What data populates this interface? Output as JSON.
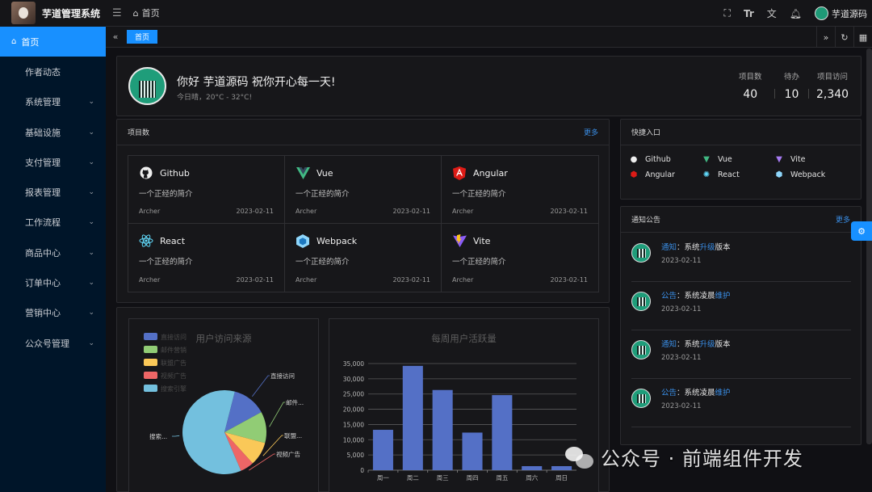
{
  "header": {
    "title": "芋道管理系统",
    "breadcrumb": "首页",
    "username": "芋道源码",
    "icons": [
      "fullscreen-icon",
      "font-size-icon",
      "translate-icon",
      "bell-icon"
    ]
  },
  "sidebar": {
    "items": [
      {
        "label": "首页",
        "active": true
      },
      {
        "label": "作者动态"
      },
      {
        "label": "系统管理"
      },
      {
        "label": "基础设施"
      },
      {
        "label": "支付管理"
      },
      {
        "label": "报表管理"
      },
      {
        "label": "工作流程"
      },
      {
        "label": "商品中心"
      },
      {
        "label": "订单中心"
      },
      {
        "label": "营销中心"
      },
      {
        "label": "公众号管理"
      }
    ]
  },
  "tabs": {
    "active": "首页"
  },
  "greeting": {
    "title": "你好 芋道源码 祝你开心每一天!",
    "weather": "今日晴，20°C - 32°C!",
    "stats": [
      {
        "label": "项目数",
        "value": "40"
      },
      {
        "label": "待办",
        "value": "10"
      },
      {
        "label": "项目访问",
        "value": "2,340"
      }
    ]
  },
  "projects": {
    "title": "项目数",
    "more": "更多",
    "items": [
      {
        "name": "Github",
        "icon": "github-icon",
        "desc": "一个正经的简介",
        "author": "Archer",
        "date": "2023-02-11"
      },
      {
        "name": "Vue",
        "icon": "vue-icon",
        "desc": "一个正经的简介",
        "author": "Archer",
        "date": "2023-02-11"
      },
      {
        "name": "Angular",
        "icon": "angular-icon",
        "desc": "一个正经的简介",
        "author": "Archer",
        "date": "2023-02-11"
      },
      {
        "name": "React",
        "icon": "react-icon",
        "desc": "一个正经的简介",
        "author": "Archer",
        "date": "2023-02-11"
      },
      {
        "name": "Webpack",
        "icon": "webpack-icon",
        "desc": "一个正经的简介",
        "author": "Archer",
        "date": "2023-02-11"
      },
      {
        "name": "Vite",
        "icon": "vite-icon",
        "desc": "一个正经的简介",
        "author": "Archer",
        "date": "2023-02-11"
      }
    ]
  },
  "quick": {
    "title": "快捷入口",
    "items": [
      "Github",
      "Vue",
      "Vite",
      "Angular",
      "React",
      "Webpack"
    ]
  },
  "notice": {
    "title": "通知公告",
    "more": "更多",
    "items": [
      {
        "type": "通知",
        "text_a": "：系统",
        "hl": "升级",
        "text_b": "版本",
        "date": "2023-02-11"
      },
      {
        "type": "公告",
        "text_a": "：系统凌晨",
        "hl": "维护",
        "text_b": "",
        "date": "2023-02-11"
      },
      {
        "type": "通知",
        "text_a": "：系统",
        "hl": "升级",
        "text_b": "版本",
        "date": "2023-02-11"
      },
      {
        "type": "公告",
        "text_a": "：系统凌晨",
        "hl": "维护",
        "text_b": "",
        "date": "2023-02-11"
      }
    ]
  },
  "watermark": "公众号 · 前端组件开发",
  "chart_data": [
    {
      "type": "pie",
      "title": "用户访问来源",
      "legend": [
        "直接访问",
        "邮件营销",
        "联盟广告",
        "视频广告",
        "搜索引擎"
      ],
      "labels": [
        "直接访问",
        "邮件...",
        "联盟...",
        "视频广告",
        "搜索..."
      ],
      "values": [
        335,
        310,
        234,
        135,
        1548
      ],
      "colors": [
        "#5470c6",
        "#91cc75",
        "#fac858",
        "#ee6666",
        "#73c0de"
      ]
    },
    {
      "type": "bar",
      "title": "每周用户活跃量",
      "categories": [
        "周一",
        "周二",
        "周三",
        "周四",
        "周五",
        "周六",
        "周日"
      ],
      "values": [
        13253,
        34235,
        26321,
        12340,
        24643,
        1322,
        1324
      ],
      "ylim": [
        0,
        35000
      ],
      "yticks": [
        "0",
        "5,000",
        "10,000",
        "15,000",
        "20,000",
        "25,000",
        "30,000",
        "35,000"
      ],
      "color": "#5470c6"
    }
  ]
}
